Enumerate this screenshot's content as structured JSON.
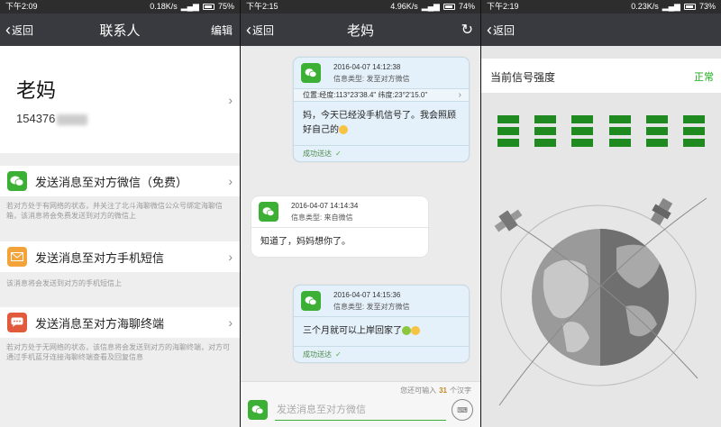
{
  "colors": {
    "titlebar": "#393a3f",
    "statusbar": "#2d2d2d",
    "wechat_green": "#3cb034",
    "sms_orange": "#f2a33a",
    "terminal_red": "#e15a3c",
    "normal_green": "#1aad19"
  },
  "screen1": {
    "status": {
      "time": "下午2:09",
      "speed": "0.18K/s",
      "battery": "75%"
    },
    "nav": {
      "back": "返回",
      "title": "联系人",
      "edit": "编辑"
    },
    "contact": {
      "name": "老妈",
      "number": "154376"
    },
    "options": [
      {
        "label": "发送消息至对方微信（免费）",
        "icon": "wechat-icon",
        "note": "若对方处于有网络的状态，并关注了北斗海聊微信公众号绑定海聊信箱，该消息将会免费发送到对方的微信上"
      },
      {
        "label": "发送消息至对方手机短信",
        "icon": "envelope-icon",
        "note": "该消息将会发送到对方的手机短信上"
      },
      {
        "label": "发送消息至对方海聊终端",
        "icon": "chat-bubble-icon",
        "note": "若对方处于无网络的状态，该信息将会发送到对方的海聊终端，对方可通过手机蓝牙连接海聊终端查看及回复信息"
      }
    ]
  },
  "screen2": {
    "status": {
      "time": "下午2:15",
      "speed": "4.96K/s",
      "battery": "74%"
    },
    "nav": {
      "back": "返回",
      "title": "老妈"
    },
    "messages": [
      {
        "date": "2016-04-07 14:12:38",
        "type": "信息类型: 发至对方微信",
        "location": "位置:经度:113°23'38.4\"  纬度:23°2'15.0\"",
        "text": "妈，今天已经没手机信号了。我会照顾好自己的",
        "status": "成功送达"
      },
      {
        "date": "2016-04-07 14:14:34",
        "type": "信息类型: 来自微信",
        "text": "知道了，妈妈想你了。"
      },
      {
        "date": "2016-04-07 14:15:36",
        "type": "信息类型: 发至对方微信",
        "text": "三个月就可以上岸回家了",
        "status": "成功送达"
      }
    ],
    "input": {
      "remain_prefix": "您还可输入",
      "remain_count": "31",
      "remain_suffix": "个汉字",
      "placeholder": "发送消息至对方微信"
    }
  },
  "screen3": {
    "status": {
      "time": "下午2:19",
      "speed": "0.23K/s",
      "battery": "73%"
    },
    "nav": {
      "back": "返回"
    },
    "signal": {
      "label": "当前信号强度",
      "value": "正常",
      "bars_columns": 6,
      "bars_per_column": 3
    }
  }
}
